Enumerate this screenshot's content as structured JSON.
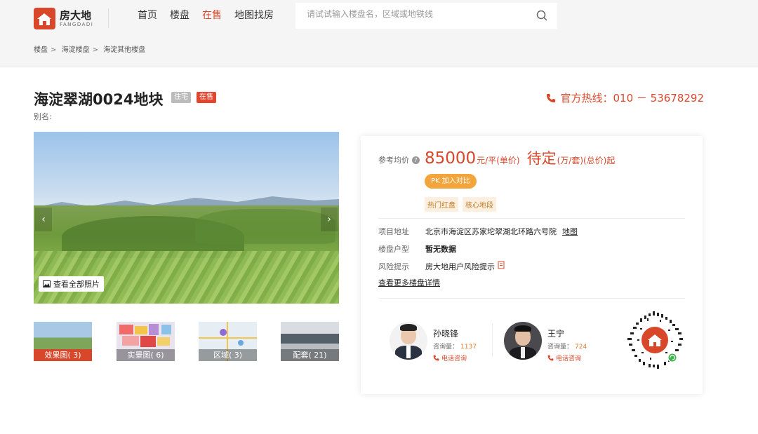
{
  "brand": {
    "name_cn": "房大地",
    "name_en": "FANGDADI"
  },
  "nav": [
    {
      "label": "首页",
      "active": false
    },
    {
      "label": "楼盘",
      "active": false
    },
    {
      "label": "在售",
      "active": true
    },
    {
      "label": "地图找房",
      "active": false
    }
  ],
  "search": {
    "placeholder": "请试试输入楼盘名，区域或地铁线",
    "icon": "search-icon"
  },
  "breadcrumb": [
    "楼盘",
    "海淀楼盘",
    "海淀其他楼盘"
  ],
  "listing": {
    "title": "海淀翠湖0024地块",
    "tag_type": "住宅",
    "tag_status": "在售",
    "alias": "别名:",
    "hotline": "官方热线：010 － 53678292"
  },
  "gallery": {
    "view_all": "查看全部照片",
    "thumbs": [
      {
        "label": "效果图( 3)",
        "active": true
      },
      {
        "label": "实景图( 6)",
        "active": false
      },
      {
        "label": "区域( 3)",
        "active": false
      },
      {
        "label": "配套( 21)",
        "active": false
      }
    ]
  },
  "price": {
    "label": "参考均价",
    "value": "85000",
    "unit": "元/平(单价)",
    "total": "待定",
    "total_unit": "(万/套)(总价)起",
    "pk_label": "PK 加入对比",
    "chips": [
      "热门红盘",
      "核心地段"
    ]
  },
  "details": {
    "address_label": "项目地址",
    "address": "北京市海淀区苏家坨翠湖北环路六号院",
    "map_link": "地图",
    "type_label": "楼盘户型",
    "type_value": "暂无数据",
    "risk_label": "风险提示",
    "risk_value": "房大地用户风险提示",
    "more_link": "查看更多楼盘详情"
  },
  "agents": [
    {
      "name": "孙晓锋",
      "count_label": "咨询量：",
      "count": "1137",
      "call": "电话咨询"
    },
    {
      "name": "王宁",
      "count_label": "咨询量：",
      "count": "724",
      "call": "电话咨询"
    }
  ],
  "colors": {
    "brand": "#d9472b",
    "pk": "#f3a43a",
    "chip_text": "#c27b2a"
  }
}
